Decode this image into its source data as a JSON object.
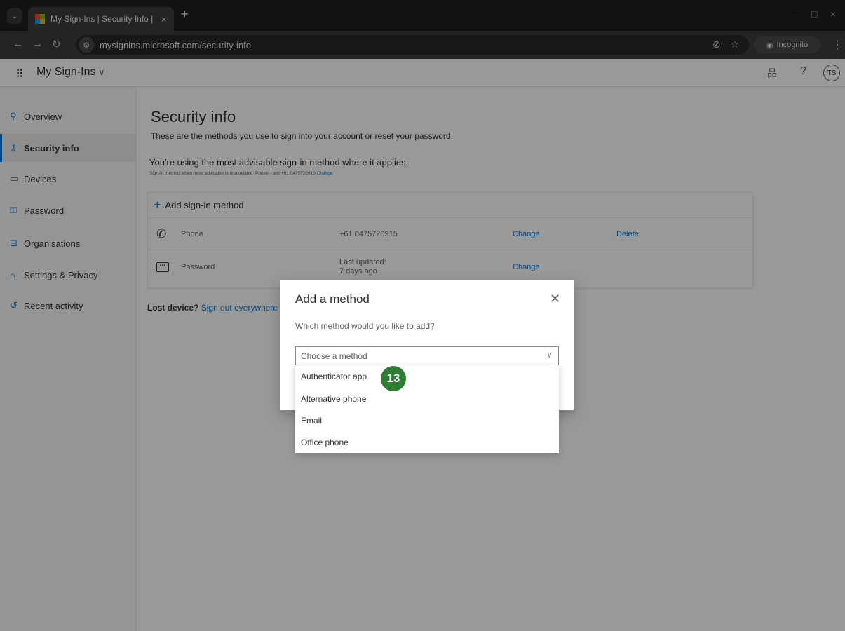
{
  "browser": {
    "tab_title": "My Sign-Ins | Security Info | Mi",
    "tab_close": "×",
    "new_tab": "+",
    "url": "mysignins.microsoft.com/security-info",
    "incognito_label": "Incognito",
    "window_controls": [
      "–",
      "□",
      "×"
    ]
  },
  "header": {
    "app_name": "My Sign-Ins",
    "avatar_initials": "TS",
    "help": "?"
  },
  "sidebar": {
    "items": [
      {
        "label": "Overview",
        "icon": "person-icon",
        "active": false
      },
      {
        "label": "Security info",
        "icon": "security-info-icon",
        "active": true
      },
      {
        "label": "Devices",
        "icon": "laptop-icon",
        "active": false
      },
      {
        "label": "Password",
        "icon": "key-icon",
        "active": false
      },
      {
        "label": "Organisations",
        "icon": "briefcase-icon",
        "active": false
      },
      {
        "label": "Settings & Privacy",
        "icon": "lock-icon",
        "active": false
      },
      {
        "label": "Recent activity",
        "icon": "history-icon",
        "active": false
      }
    ]
  },
  "main": {
    "title": "Security info",
    "subtitle": "These are the methods you use to sign into your account or reset your password.",
    "advisable": "You're using the most advisable sign-in method where it applies.",
    "advisable_small": "Sign-in method when most advisable is unavailable: Phone - text +61 0475720915",
    "advisable_small_link": "Change",
    "add_method": "Add sign-in method",
    "methods": [
      {
        "name": "Phone",
        "detail": "+61 0475720915",
        "change": "Change",
        "delete": "Delete"
      },
      {
        "name": "Password",
        "detail_line1": "Last updated:",
        "detail_line2": "7 days ago",
        "change": "Change"
      }
    ],
    "lost_device": "Lost device?",
    "sign_out": "Sign out everywhere"
  },
  "dialog": {
    "title": "Add a method",
    "question": "Which method would you like to add?",
    "select_placeholder": "Choose a method",
    "options": [
      "Authenticator app",
      "Alternative phone",
      "Email",
      "Office phone"
    ]
  },
  "annotation": {
    "step": "13",
    "color": "#2e7d32"
  },
  "colors": {
    "accent": "#0078d4",
    "overlay": "rgba(0,0,0,0.4)"
  }
}
